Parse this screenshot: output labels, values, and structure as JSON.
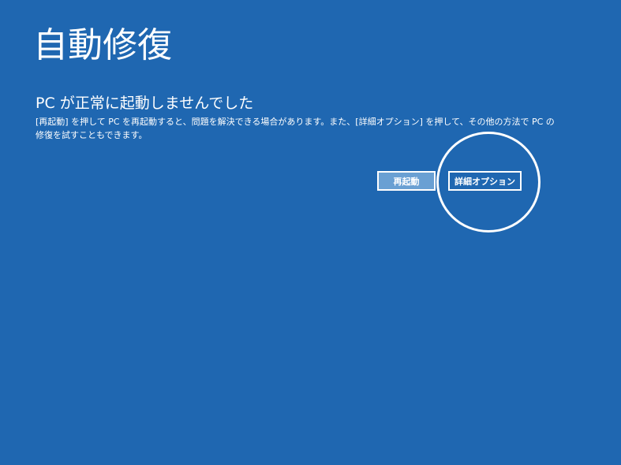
{
  "screen": {
    "title": "自動修復",
    "subtitle": "PC が正常に起動しませんでした",
    "description_lines": [
      "[再起動] を押して PC を再起動すると、問題を解決できる場合があります。また、[詳細オプション] を押して、その他の方法で PC の",
      "修復を試すこともできます。"
    ]
  },
  "buttons": {
    "restart_label": "再起動",
    "advanced_label": "詳細オプション"
  },
  "colors": {
    "background": "#1f67b1",
    "restart_button_bg": "#6aa0d3",
    "text": "#ffffff"
  }
}
